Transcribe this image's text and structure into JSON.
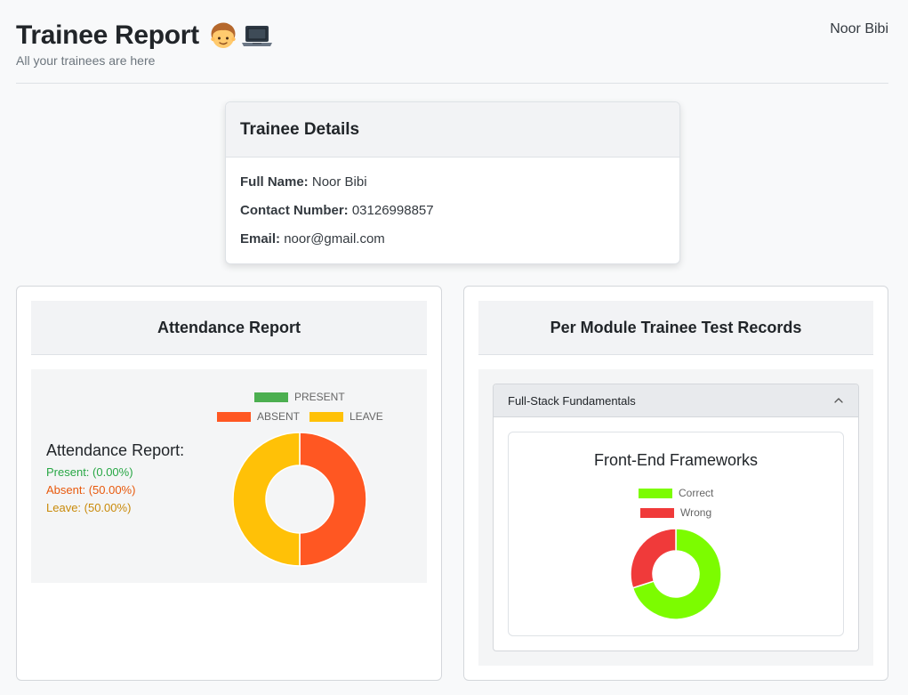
{
  "header": {
    "title": "Trainee Report",
    "title_icons": [
      "boy-icon",
      "laptop-icon"
    ],
    "subtitle": "All your trainees are here",
    "user_name": "Noor Bibi"
  },
  "trainee_details": {
    "heading": "Trainee Details",
    "full_name_label": "Full Name:",
    "full_name": "Noor Bibi",
    "contact_label": "Contact Number:",
    "contact": "03126998857",
    "email_label": "Email:",
    "email": "noor@gmail.com"
  },
  "attendance": {
    "heading": "Attendance Report",
    "summary_title": "Attendance Report:",
    "present_text": "Present: (0.00%)",
    "absent_text": "Absent: (50.00%)",
    "leave_text": "Leave: (50.00%)"
  },
  "test_records": {
    "heading": "Per Module Trainee Test Records",
    "accordion_title": "Full-Stack Fundamentals",
    "module_title": "Front-End Frameworks"
  },
  "chart_data": [
    {
      "type": "pie",
      "variant": "doughnut",
      "labels": [
        "PRESENT",
        "ABSENT",
        "LEAVE"
      ],
      "values": [
        0,
        50,
        50
      ],
      "colors": [
        "#4caf50",
        "#ff5722",
        "#ffc107"
      ],
      "legend": "top"
    },
    {
      "type": "pie",
      "variant": "doughnut",
      "title": "Front-End Frameworks",
      "labels": [
        "Correct",
        "Wrong"
      ],
      "values": [
        70,
        30
      ],
      "colors": [
        "#7cfc00",
        "#f03a3a"
      ],
      "legend": "top"
    }
  ]
}
